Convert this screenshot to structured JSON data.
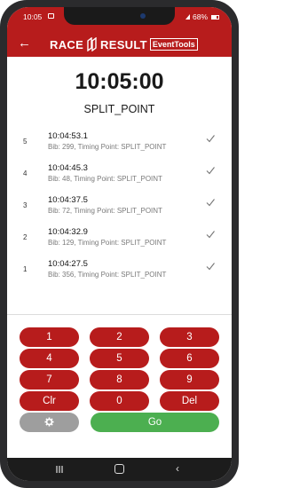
{
  "status_bar": {
    "time": "10:05",
    "battery": "68%"
  },
  "header": {
    "back_icon": "arrow-left-icon",
    "logo_part1": "RACE",
    "logo_part2": "RESULT",
    "logo_badge": "EventTools",
    "bar_color": "#b71c1c"
  },
  "main": {
    "current_time": "10:05:00",
    "split_point": "SPLIT_POINT"
  },
  "records": [
    {
      "num": "5",
      "time": "10:04:53.1",
      "details": "Bib: 299, Timing Point: SPLIT_POINT",
      "icon": "check-icon"
    },
    {
      "num": "4",
      "time": "10:04:45.3",
      "details": "Bib: 48, Timing Point: SPLIT_POINT",
      "icon": "check-icon"
    },
    {
      "num": "3",
      "time": "10:04:37.5",
      "details": "Bib: 72, Timing Point: SPLIT_POINT",
      "icon": "check-icon"
    },
    {
      "num": "2",
      "time": "10:04:32.9",
      "details": "Bib: 129, Timing Point: SPLIT_POINT",
      "icon": "check-icon"
    },
    {
      "num": "1",
      "time": "10:04:27.5",
      "details": "Bib: 356, Timing Point: SPLIT_POINT",
      "icon": "check-icon"
    }
  ],
  "keypad": {
    "keys": [
      "1",
      "2",
      "3",
      "4",
      "5",
      "6",
      "7",
      "8",
      "9",
      "Clr",
      "0",
      "Del"
    ],
    "settings_icon": "gear-icon",
    "go_label": "Go",
    "key_color": "#b71c1c",
    "go_color": "#4caf50",
    "settings_color": "#9e9e9e"
  },
  "nav": {
    "recents_icon": "recents-icon",
    "home_icon": "home-icon",
    "back_icon": "back-icon"
  }
}
